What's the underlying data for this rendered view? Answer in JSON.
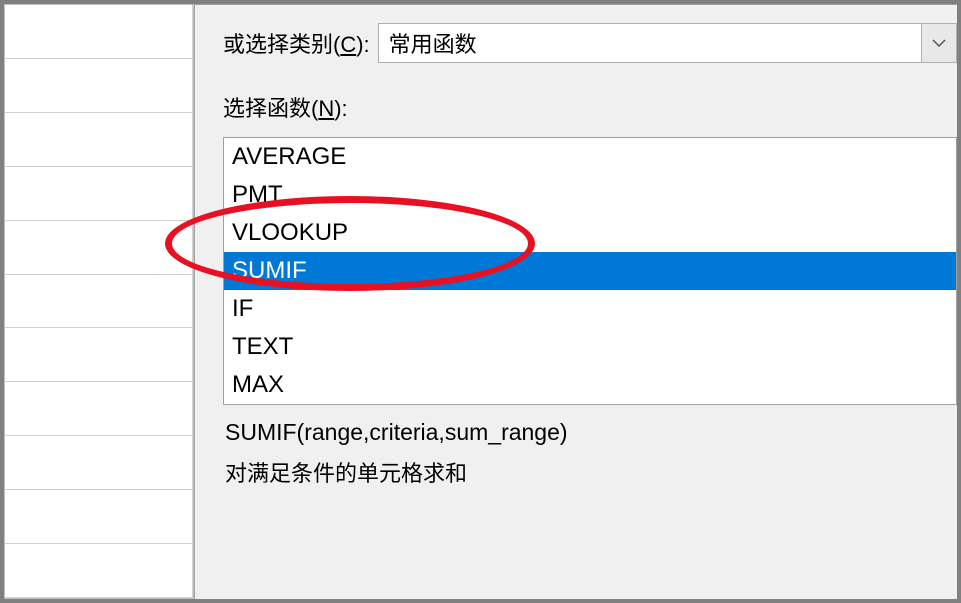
{
  "labels": {
    "category_prefix": "或选择类别(",
    "category_hotkey": "C",
    "category_suffix": "):",
    "select_prefix": "选择函数(",
    "select_hotkey": "N",
    "select_suffix": "):"
  },
  "category_dropdown": {
    "value": "常用函数"
  },
  "function_list": [
    {
      "name": "AVERAGE",
      "selected": false
    },
    {
      "name": "PMT",
      "selected": false
    },
    {
      "name": "VLOOKUP",
      "selected": false
    },
    {
      "name": "SUMIF",
      "selected": true
    },
    {
      "name": "IF",
      "selected": false
    },
    {
      "name": "TEXT",
      "selected": false
    },
    {
      "name": "MAX",
      "selected": false
    }
  ],
  "syntax": "SUMIF(range,criteria,sum_range)",
  "description": "对满足条件的单元格求和"
}
